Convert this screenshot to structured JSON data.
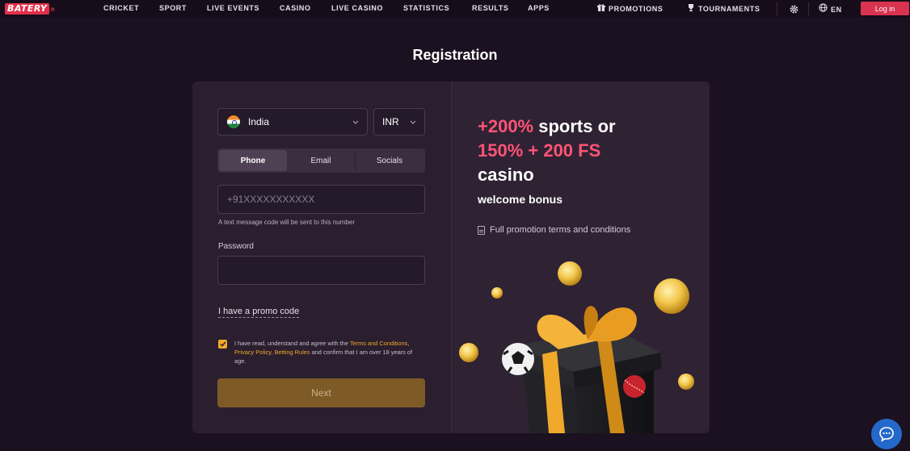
{
  "header": {
    "logo": "BATERY",
    "nav": [
      "CRICKET",
      "SPORT",
      "LIVE EVENTS",
      "CASINO",
      "LIVE CASINO",
      "STATISTICS",
      "RESULTS",
      "APPS"
    ],
    "promotions": "PROMOTIONS",
    "tournaments": "TOURNAMENTS",
    "language": "EN",
    "login": "Log in"
  },
  "page": {
    "title": "Registration"
  },
  "form": {
    "country": "India",
    "currency": "INR",
    "tabs": [
      "Phone",
      "Email",
      "Socials"
    ],
    "active_tab": "Phone",
    "phone_placeholder": "+91XXXXXXXXXXX",
    "phone_hint": "A text message code will be sent to this number",
    "password_label": "Password",
    "password_value": "",
    "promo_link": "I have a promo code",
    "terms": {
      "prefix": "I have read, understand and agree with the ",
      "link1": "Terms and Conditions",
      "sep1": ", ",
      "link2": "Privacy Policy",
      "sep2": ", ",
      "link3": "Betting Rules",
      "suffix": " and confirm that I am over 18 years of age."
    },
    "next": "Next"
  },
  "promo": {
    "line1_highlight": "+200%",
    "line1_rest": " sports or",
    "line2_highlight": "150% + 200 FS",
    "line3": "casino",
    "welcome": "welcome bonus",
    "terms_link": "Full promotion terms and conditions"
  },
  "colors": {
    "background": "#1c1120",
    "accent_red": "#d8334f",
    "promo_pink": "#ff5476",
    "gold": "#f0a92a",
    "next_button": "#7e5a27",
    "chat": "#2468c9"
  }
}
